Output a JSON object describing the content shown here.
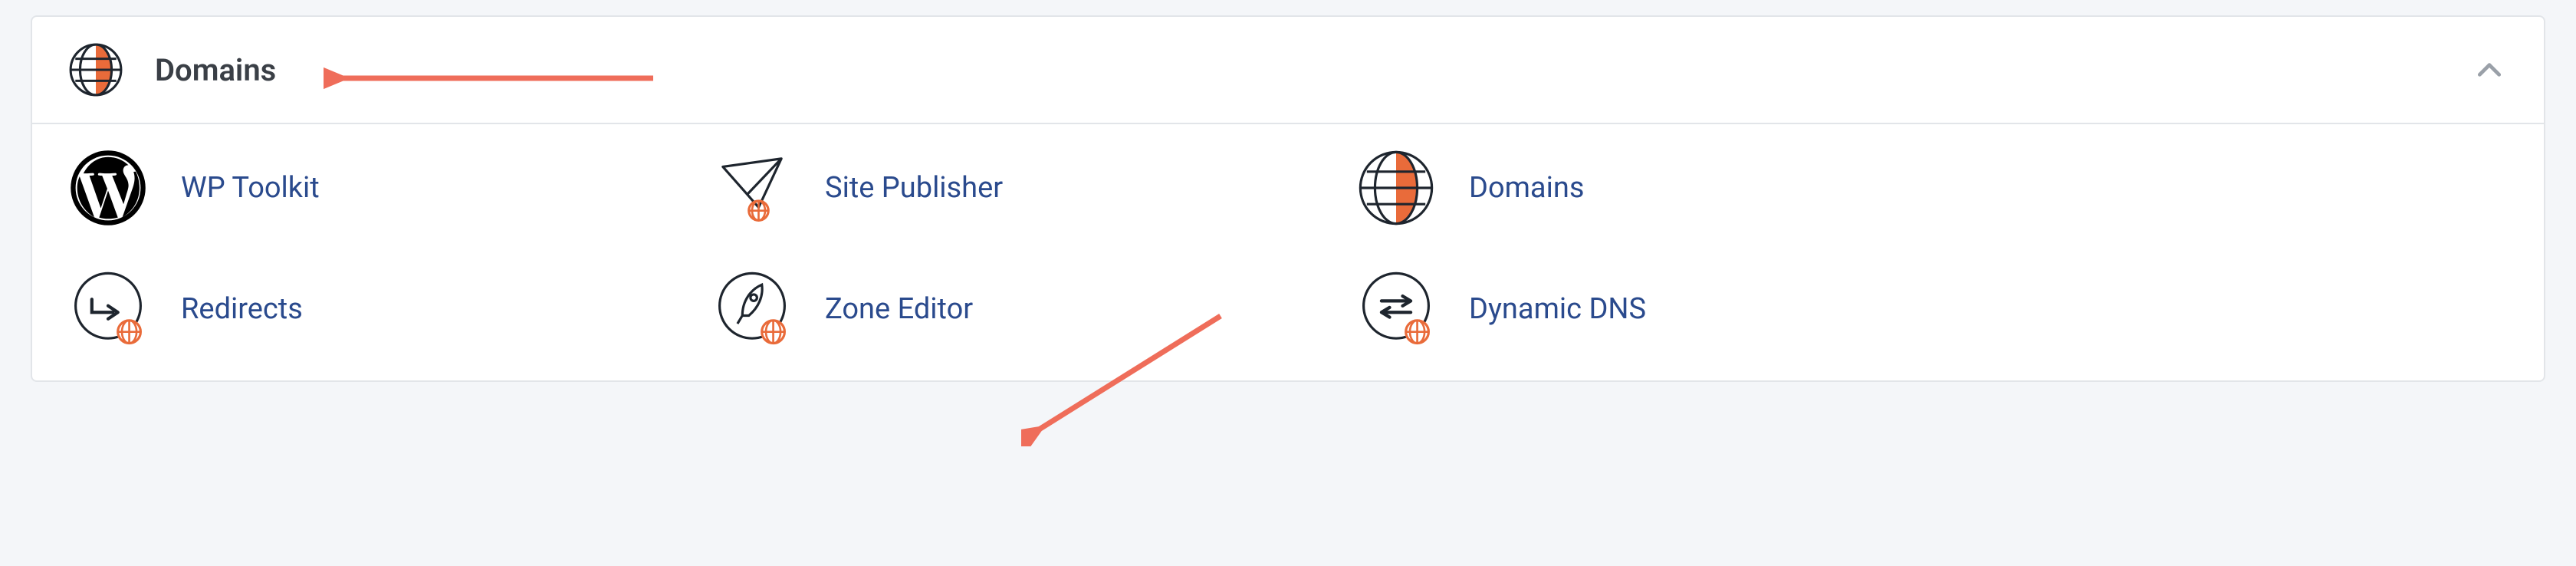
{
  "panel": {
    "title": "Domains",
    "items": [
      {
        "label": "WP Toolkit"
      },
      {
        "label": "Site Publisher"
      },
      {
        "label": "Domains"
      },
      {
        "label": "Redirects"
      },
      {
        "label": "Zone Editor"
      },
      {
        "label": "Dynamic DNS"
      }
    ]
  },
  "colors": {
    "accent": "#e96b3a",
    "link": "#2a4a8d",
    "annotation": "#ef6d5a"
  }
}
